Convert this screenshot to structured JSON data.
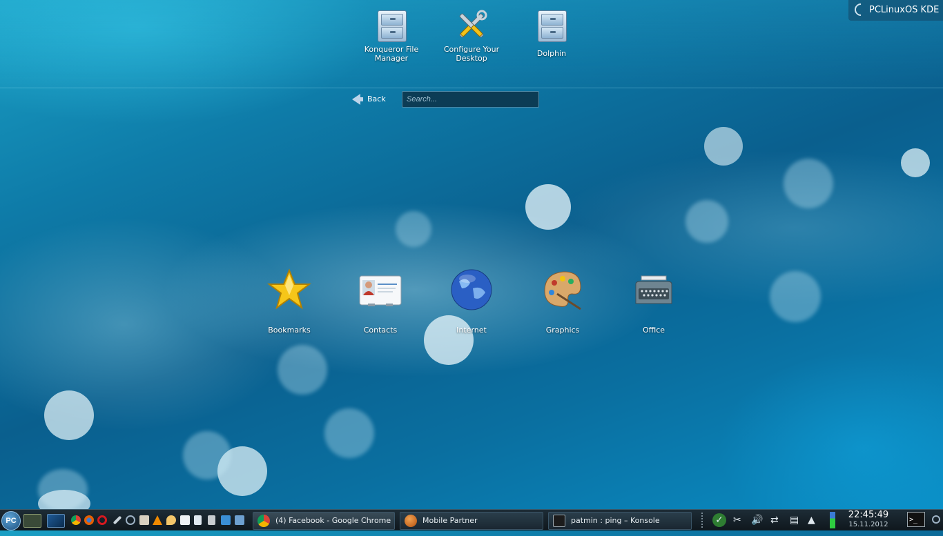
{
  "favorites": [
    {
      "label": "Konqueror File Manager",
      "icon": "file-cabinet-icon"
    },
    {
      "label": "Configure Your Desktop",
      "icon": "tools-icon"
    },
    {
      "label": "Dolphin",
      "icon": "file-cabinet-icon"
    }
  ],
  "activity_button": {
    "label": "PCLinuxOS KDE"
  },
  "navigation": {
    "back_label": "Back"
  },
  "search": {
    "placeholder": "Search..."
  },
  "categories": [
    {
      "label": "Bookmarks",
      "icon": "star-icon"
    },
    {
      "label": "Contacts",
      "icon": "contact-card-icon"
    },
    {
      "label": "Internet",
      "icon": "globe-icon"
    },
    {
      "label": "Graphics",
      "icon": "paint-palette-icon"
    },
    {
      "label": "Office",
      "icon": "typewriter-icon"
    }
  ],
  "taskbar": {
    "kickoff_label": "PC",
    "tasks": [
      {
        "label": "(4) Facebook - Google Chrome",
        "icon": "chrome-icon"
      },
      {
        "label": "Mobile Partner",
        "icon": "mobile-partner-icon"
      },
      {
        "label": "patmin : ping – Konsole",
        "icon": "terminal-icon"
      }
    ],
    "clock": {
      "time": "22:45:49",
      "date": "15.11.2012"
    }
  },
  "colors": {
    "accent": "#0a6fa0",
    "panel": "#0f171d"
  }
}
